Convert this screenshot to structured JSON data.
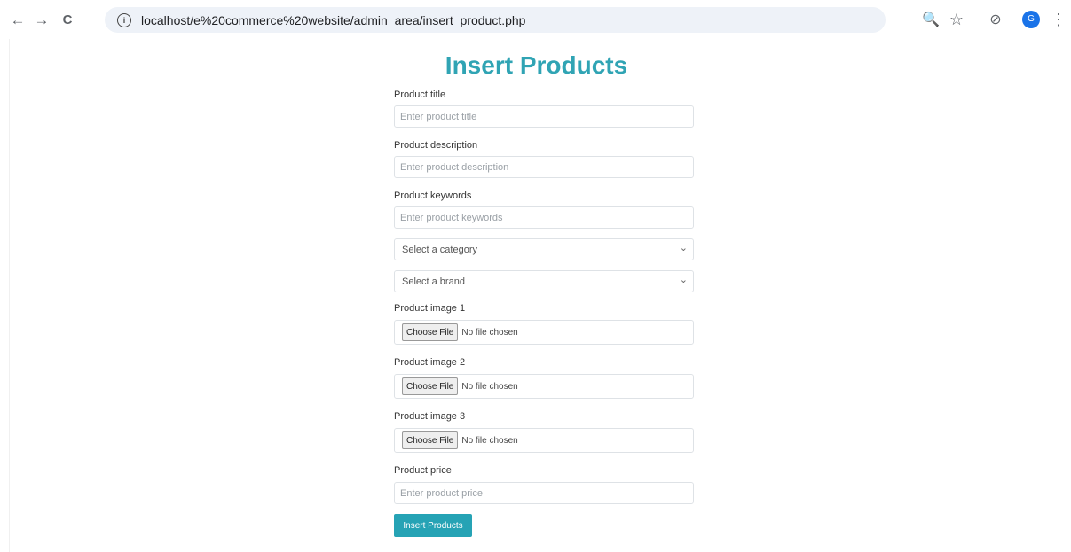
{
  "browser": {
    "url": "localhost/e%20commerce%20website/admin_area/insert_product.php",
    "back_icon": "←",
    "forward_icon": "→",
    "reload_icon": "C",
    "info_icon": "i",
    "zoom_icon": "🔍",
    "star_icon": "☆",
    "extension_icon": "⊘",
    "avatar_letter": "G",
    "menu_icon": "⋮"
  },
  "page": {
    "title": "Insert Products",
    "form": {
      "title_label": "Product title",
      "title_placeholder": "Enter product title",
      "description_label": "Product description",
      "description_placeholder": "Enter product description",
      "keywords_label": "Product keywords",
      "keywords_placeholder": "Enter product keywords",
      "category_select": "Select a category",
      "brand_select": "Select a brand",
      "image1_label": "Product image 1",
      "image2_label": "Product image 2",
      "image3_label": "Product image 3",
      "choose_file": "Choose File",
      "no_file": "No file chosen",
      "price_label": "Product price",
      "price_placeholder": "Enter product price",
      "submit": "Insert Products"
    }
  },
  "colors": {
    "accent": "#30a4b4",
    "button": "#26a3b5"
  }
}
